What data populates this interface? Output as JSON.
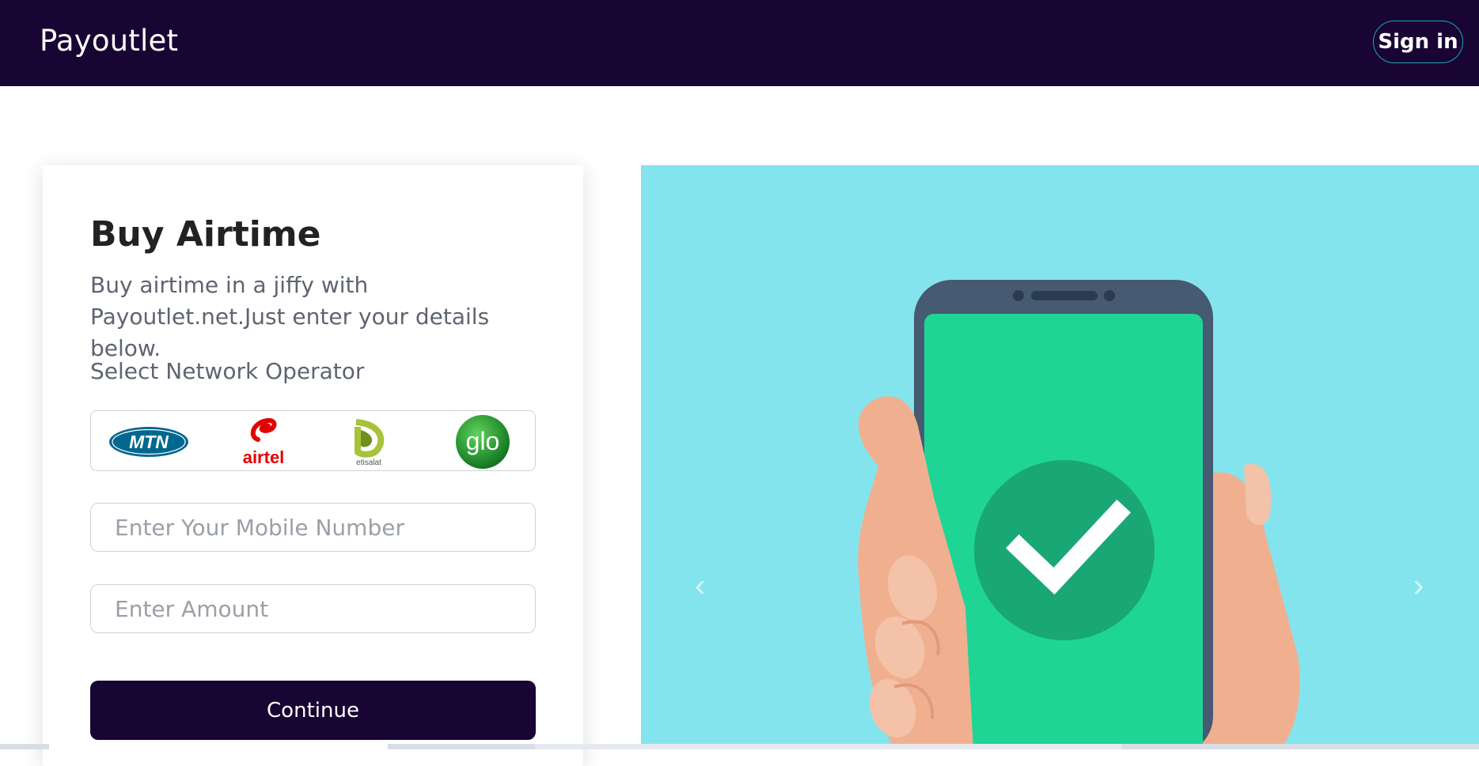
{
  "header": {
    "brand": "Payoutlet",
    "signin_label": "Sign in"
  },
  "form": {
    "title": "Buy Airtime",
    "description": "Buy airtime in a jiffy with Payoutlet.net.Just enter your details below.",
    "network_label": "Select Network Operator",
    "networks": [
      {
        "name": "MTN",
        "logo_text": "MTN",
        "color": "#00678f"
      },
      {
        "name": "airtel",
        "logo_text": "airtel",
        "color": "#e40000"
      },
      {
        "name": "etisalat",
        "logo_text": "etisalat",
        "color": "#a7c23b"
      },
      {
        "name": "glo",
        "logo_text": "glo",
        "color": "#1a9a2f"
      }
    ],
    "mobile_placeholder": "Enter Your Mobile Number",
    "amount_placeholder": "Enter Amount",
    "continue_label": "Continue"
  },
  "carousel": {
    "background_color": "#84e4ee",
    "prev_icon": "chevron-left-icon",
    "next_icon": "chevron-right-icon",
    "prev_glyph": "‹",
    "next_glyph": "›",
    "slide_illustration": "hand-holding-phone-checkmark"
  }
}
